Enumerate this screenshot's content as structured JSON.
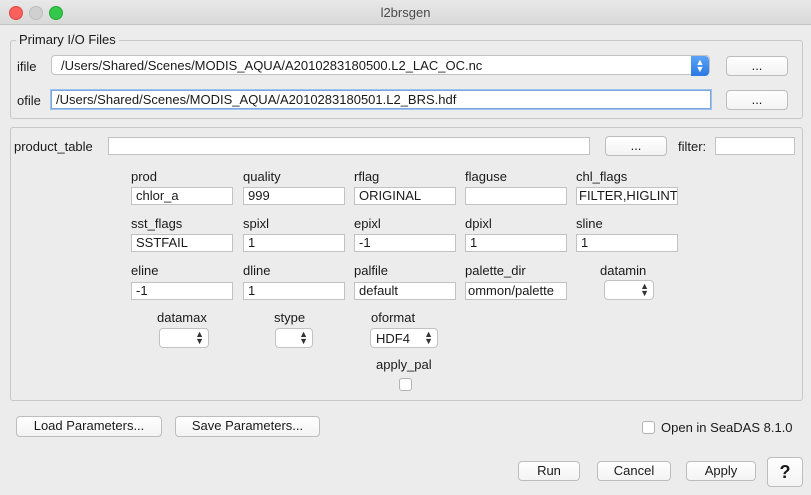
{
  "window": {
    "title": "l2brsgen"
  },
  "io": {
    "legend": "Primary I/O Files",
    "ifile_label": "ifile",
    "ifile_value": "/Users/Shared/Scenes/MODIS_AQUA/A2010283180500.L2_LAC_OC.nc",
    "ofile_label": "ofile",
    "ofile_value": "/Users/Shared/Scenes/MODIS_AQUA/A2010283180501.L2_BRS.hdf",
    "browse_label": "..."
  },
  "product": {
    "label": "product_table",
    "value": "",
    "browse_label": "...",
    "filter_label": "filter:",
    "filter_value": ""
  },
  "params": {
    "prod": {
      "label": "prod",
      "value": "chlor_a"
    },
    "quality": {
      "label": "quality",
      "value": "999"
    },
    "rflag": {
      "label": "rflag",
      "value": "ORIGINAL"
    },
    "flaguse": {
      "label": "flaguse",
      "value": ""
    },
    "chl_flags": {
      "label": "chl_flags",
      "value": "FILTER,HIGLINT"
    },
    "sst_flags": {
      "label": "sst_flags",
      "value": "SSTFAIL"
    },
    "spixl": {
      "label": "spixl",
      "value": "1"
    },
    "epixl": {
      "label": "epixl",
      "value": "-1"
    },
    "dpixl": {
      "label": "dpixl",
      "value": "1"
    },
    "sline": {
      "label": "sline",
      "value": "1"
    },
    "eline": {
      "label": "eline",
      "value": "-1"
    },
    "dline": {
      "label": "dline",
      "value": "1"
    },
    "palfile": {
      "label": "palfile",
      "value": "default"
    },
    "palette_dir": {
      "label": "palette_dir",
      "value": "ommon/palette"
    },
    "datamin": {
      "label": "datamin",
      "value": ""
    },
    "datamax": {
      "label": "datamax",
      "value": ""
    },
    "stype": {
      "label": "stype",
      "value": ""
    },
    "oformat": {
      "label": "oformat",
      "value": "HDF4"
    },
    "apply_pal": {
      "label": "apply_pal",
      "checked": false
    }
  },
  "footer": {
    "load_label": "Load Parameters...",
    "save_label": "Save Parameters...",
    "open_seadas_label": "Open in SeaDAS 8.1.0",
    "run_label": "Run",
    "cancel_label": "Cancel",
    "apply_label": "Apply",
    "help_label": "?"
  },
  "icons": {
    "stepper": "up-down-arrows-icon"
  }
}
